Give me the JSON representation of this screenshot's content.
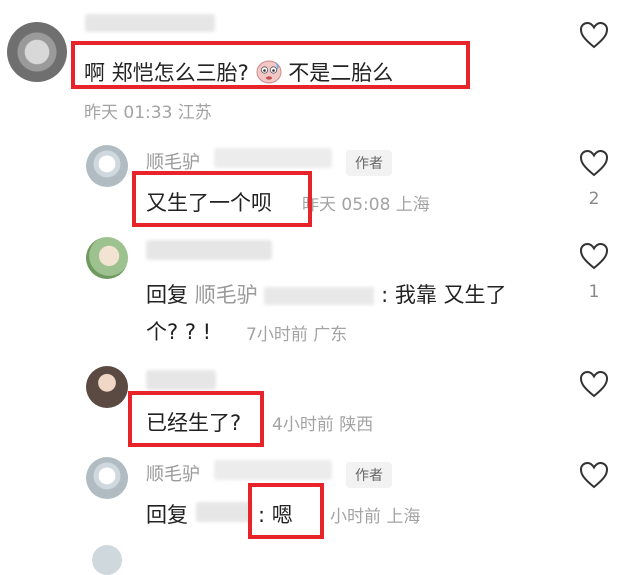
{
  "comments": [
    {
      "text_a": "啊 郑恺怎么三胎?",
      "text_b": "不是二胎么",
      "meta": "昨天 01:33 江苏",
      "likes": ""
    },
    {
      "author": "顺毛驴",
      "badge": "作者",
      "text": "又生了一个呗",
      "meta": "昨天 05:08 上海",
      "likes": "2"
    },
    {
      "reply_prefix": "回复",
      "reply_to": "顺毛驴",
      "text_line1": ": 我靠 又生了",
      "text_line2": "个? ? !",
      "meta": "7小时前 广东",
      "likes": "1"
    },
    {
      "text": "已经生了?",
      "meta": "4小时前 陕西",
      "likes": ""
    },
    {
      "author": "顺毛驴",
      "badge": "作者",
      "reply_prefix": "回复",
      "text": ": 嗯",
      "meta": "小时前 上海",
      "likes": ""
    }
  ],
  "icons": {
    "like": "heart-outline-icon",
    "emoji": "blushing-face-emoji"
  },
  "colors": {
    "highlight_box": "#e8242b",
    "meta_text": "#a3a3a3"
  }
}
